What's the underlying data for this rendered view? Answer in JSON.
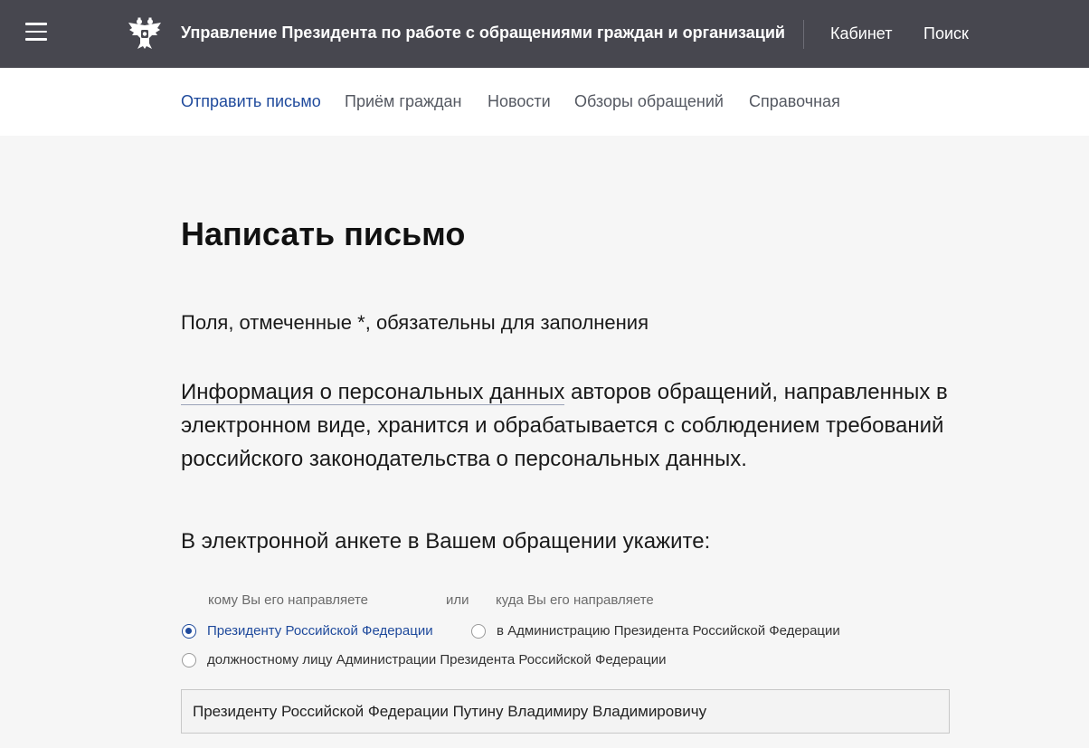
{
  "header": {
    "title": "Управление Президента по работе с обращениями граждан и организаций",
    "links": {
      "cabinet": "Кабинет",
      "search": "Поиск"
    },
    "bg_color": "#47474f"
  },
  "subnav": {
    "items": [
      {
        "label": "Отправить письмо",
        "active": true
      },
      {
        "label": "Приём граждан"
      },
      {
        "label": "Новости"
      },
      {
        "label": "Обзоры обращений"
      },
      {
        "label": "Справочная"
      }
    ],
    "accent_color": "#1f4a9c"
  },
  "main": {
    "title": "Написать письмо",
    "required_note": "Поля, отмеченные *, обязательны для заполнения",
    "info_link": "Информация о персональных данных",
    "info_rest": " авторов обращений, направленных в электронном виде, хранится и обрабатывается с соблюдением требований российского законодательства о персональных данных.",
    "form_heading": "В электронной анкете в Вашем обращении укажите:",
    "hints": {
      "whom": "кому Вы его направляете",
      "or": "или",
      "where": "куда Вы его направляете"
    },
    "radio_options": [
      {
        "label": "Президенту Российской Федерации",
        "checked": true
      },
      {
        "label": "в Администрацию Президента Российской Федерации",
        "checked": false
      },
      {
        "label": "должностному лицу Администрации Президента Российской Федерации",
        "checked": false
      }
    ],
    "recipient_value": "Президенту Российской Федерации Путину Владимиру Владимировичу"
  }
}
